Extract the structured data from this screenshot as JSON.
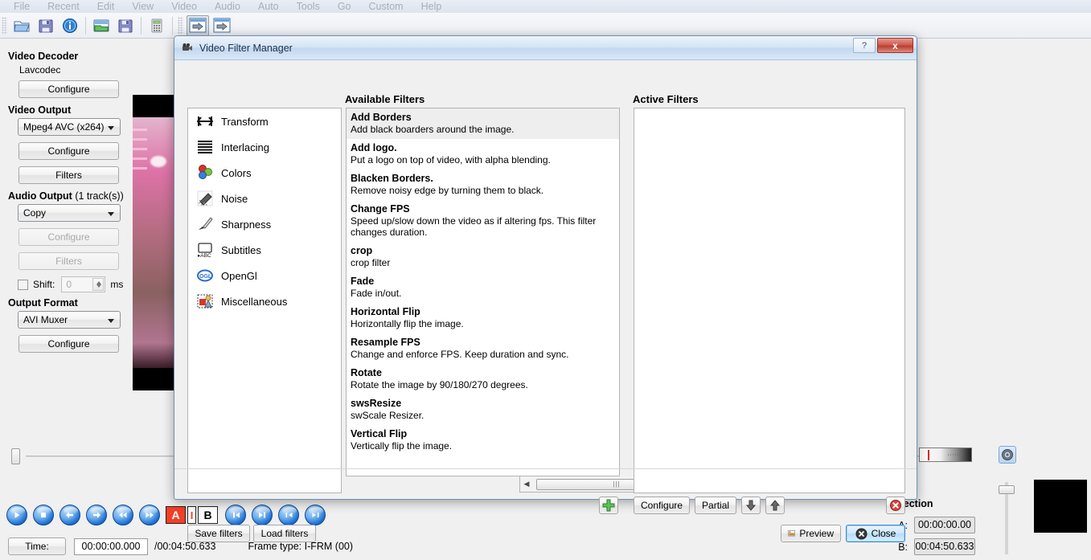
{
  "menubar": {
    "items": [
      "File",
      "Recent",
      "Edit",
      "View",
      "Video",
      "Audio",
      "Auto",
      "Tools",
      "Go",
      "Custom",
      "Help"
    ]
  },
  "toolbar": {
    "buttons": [
      {
        "name": "open-file-icon",
        "label": ""
      },
      {
        "name": "save-icon",
        "label": ""
      },
      {
        "name": "info-icon",
        "label": ""
      },
      {
        "name": "open-project-icon",
        "label": ""
      },
      {
        "name": "save-project-icon",
        "label": ""
      },
      {
        "name": "calculator-icon",
        "label": ""
      },
      {
        "name": "jobs-icon",
        "label": ""
      },
      {
        "name": "encode-icon",
        "label": ""
      }
    ]
  },
  "sidebar": {
    "video_decoder": {
      "title": "Video Decoder",
      "value": "Lavcodec",
      "configure_label": "Configure"
    },
    "video_output": {
      "title": "Video Output",
      "codec": "Mpeg4 AVC (x264)",
      "configure_label": "Configure",
      "filters_label": "Filters"
    },
    "audio_output": {
      "title": "Audio Output",
      "title_suffix": " (1 track(s))",
      "mode": "Copy",
      "configure_label": "Configure",
      "filters_label": "Filters",
      "shift_label": "Shift:",
      "shift_value": "0",
      "shift_units": "ms"
    },
    "output_format": {
      "title": "Output Format",
      "muxer": "AVI Muxer",
      "configure_label": "Configure"
    }
  },
  "dialog": {
    "title": "Video Filter Manager",
    "help_label": "?",
    "close_label": "x",
    "available_header": "Available Filters",
    "active_header": "Active Filters",
    "categories": [
      {
        "label": "Transform",
        "icon": "transform-icon"
      },
      {
        "label": "Interlacing",
        "icon": "interlacing-icon"
      },
      {
        "label": "Colors",
        "icon": "colors-icon"
      },
      {
        "label": "Noise",
        "icon": "noise-icon"
      },
      {
        "label": "Sharpness",
        "icon": "sharpness-icon"
      },
      {
        "label": "Subtitles",
        "icon": "subtitles-icon"
      },
      {
        "label": "OpenGl",
        "icon": "opengl-icon"
      },
      {
        "label": "Miscellaneous",
        "icon": "miscellaneous-icon"
      }
    ],
    "filters": [
      {
        "name": "Add Borders",
        "desc": "Add black boarders around the image.",
        "selected": true
      },
      {
        "name": "Add logo.",
        "desc": "Put a logo on top of video, with alpha blending.",
        "selected": false
      },
      {
        "name": "Blacken Borders.",
        "desc": "Remove noisy edge by turning them to black.",
        "selected": false
      },
      {
        "name": "Change FPS",
        "desc": "Speed up/slow down the video as if altering fps. This filter changes duration.",
        "selected": false
      },
      {
        "name": "crop",
        "desc": "crop filter",
        "selected": false
      },
      {
        "name": "Fade",
        "desc": "Fade in/out.",
        "selected": false
      },
      {
        "name": "Horizontal Flip",
        "desc": "Horizontally flip the image.",
        "selected": false
      },
      {
        "name": "Resample FPS",
        "desc": "Change and enforce FPS. Keep duration and sync.",
        "selected": false
      },
      {
        "name": "Rotate",
        "desc": "Rotate the image by 90/180/270 degrees.",
        "selected": false
      },
      {
        "name": "swsResize",
        "desc": "swScale Resizer.",
        "selected": false
      },
      {
        "name": "Vertical Flip",
        "desc": "Vertically flip the image.",
        "selected": false
      }
    ],
    "active_filters": [],
    "add_filter_icon": "add-plus-icon",
    "active_toolbar": {
      "configure_label": "Configure",
      "partial_label": "Partial",
      "move_down_icon": "arrow-down-icon",
      "move_up_icon": "arrow-up-icon",
      "remove_icon": "remove-cross-icon"
    },
    "save_filters_label": "Save filters",
    "load_filters_label": "Load filters",
    "preview_label": "Preview",
    "close_button_label": "Close"
  },
  "playback": {
    "controls": [
      {
        "name": "play-button",
        "icon": "play-icon"
      },
      {
        "name": "stop-button",
        "icon": "stop-icon"
      },
      {
        "name": "previous-frame-button",
        "icon": "arrow-left-icon"
      },
      {
        "name": "next-frame-button",
        "icon": "arrow-right-icon"
      },
      {
        "name": "rewind-button",
        "icon": "rewind-icon"
      },
      {
        "name": "fast-forward-button",
        "icon": "fast-forward-icon"
      }
    ],
    "marker_a_label": "A",
    "marker_i_label": "I",
    "marker_b_label": "B",
    "nav_controls": [
      {
        "name": "go-to-marker-a-button",
        "icon": "skip-start-icon"
      },
      {
        "name": "go-to-marker-b-button",
        "icon": "skip-end-icon"
      },
      {
        "name": "go-to-start-button",
        "icon": "first-frame-icon"
      },
      {
        "name": "go-to-end-button",
        "icon": "last-frame-icon"
      }
    ]
  },
  "statusbar": {
    "time_label": "Time:",
    "current_time": "00:00:00.000",
    "duration": "/00:04:50.633",
    "frame_type": "Frame type:  I-FRM (00)"
  },
  "selection": {
    "title": "Selection",
    "a_label": "A:",
    "a_value": "00:00:00.00",
    "b_label": "B:",
    "b_value": "00:04:50.633"
  },
  "volume": {
    "speaker_icon": "speaker-icon"
  },
  "colors": {
    "accent": "#3c8fd4",
    "title_bar_from": "#eef4fb",
    "title_bar_to": "#d9e8f7",
    "close_red": "#bb3f32",
    "marker_red": "#f24027",
    "window_bg": "#f0f0f0",
    "selected_row": "#eeeeee"
  }
}
